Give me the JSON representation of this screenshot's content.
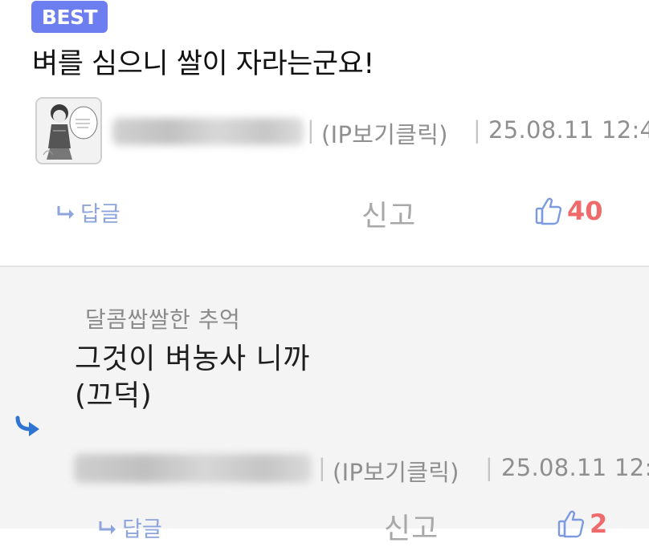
{
  "best_comment": {
    "badge": "BEST",
    "text": "벼를 심으니 쌀이 자라는군요!",
    "author_hidden": "",
    "ip_label": "(IP보기클릭)",
    "separator": "|",
    "date": "25.08.11 12:4",
    "reply_label": "답글",
    "report_label": "신고",
    "like_count": "40"
  },
  "reply": {
    "author": "달콤쌉쌀한 추억",
    "line1": "그것이 벼농사 니까",
    "line2": "(끄덕)",
    "ip_label": "(IP보기클릭)",
    "separator": "|",
    "date": "25.08.11 12:",
    "reply_label": "답글",
    "report_label": "신고",
    "like_count": "2"
  },
  "colors": {
    "badge": "#6d7ef0",
    "reply_link": "#8ea4dc",
    "like_count": "#ef6b6b",
    "thumb_icon": "#7c9ae0",
    "reply_arrow": "#2f74d0",
    "reply_background": "#f4f4f5"
  },
  "icons": [
    "reply-arrow-icon",
    "thumbs-up-icon",
    "nested-reply-arrow-icon"
  ]
}
